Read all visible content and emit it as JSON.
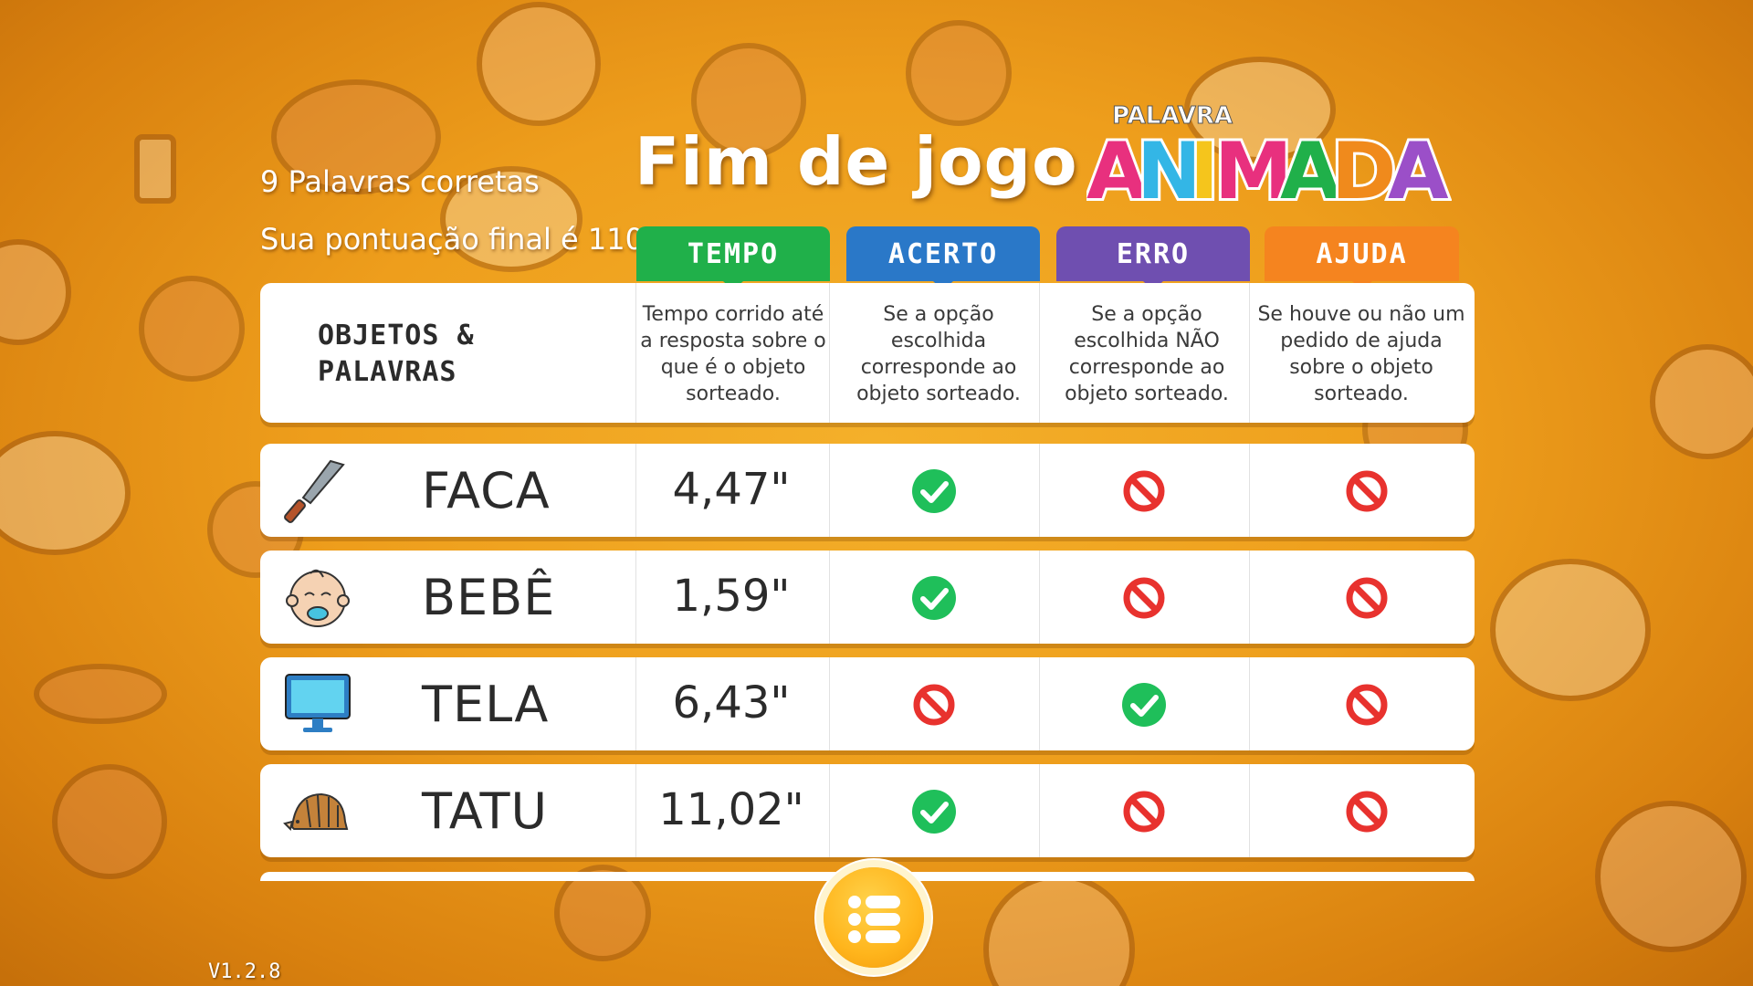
{
  "game": {
    "title": "Fim de jogo",
    "logo": {
      "top": "PALAVRA",
      "main": "ANIMADA"
    },
    "stats": {
      "correct_words": "9 Palavras corretas",
      "final_score": "Sua pontuação final é 110"
    },
    "version": "V1.2.8"
  },
  "table": {
    "header_title_line1": "OBJETOS &",
    "header_title_line2": "PALAVRAS",
    "columns": [
      {
        "label": "TEMPO",
        "color": "#20b04a",
        "description": "Tempo corrido até a resposta sobre o que é o objeto sorteado."
      },
      {
        "label": "ACERTO",
        "color": "#2a78c8",
        "description": "Se a opção escolhida corresponde ao objeto sorteado."
      },
      {
        "label": "ERRO",
        "color": "#6f4fb0",
        "description": "Se a opção escolhida NÃO corresponde ao objeto sorteado."
      },
      {
        "label": "AJUDA",
        "color": "#f5841f",
        "description": "Se houve ou não um pedido de ajuda sobre o objeto sorteado."
      }
    ],
    "rows": [
      {
        "word": "FACA",
        "icon": "knife-icon",
        "time": "4,47\"",
        "acerto": true,
        "erro": false,
        "ajuda": false
      },
      {
        "word": "BEBÊ",
        "icon": "baby-icon",
        "time": "1,59\"",
        "acerto": true,
        "erro": false,
        "ajuda": false
      },
      {
        "word": "TELA",
        "icon": "monitor-icon",
        "time": "6,43\"",
        "acerto": false,
        "erro": true,
        "ajuda": false
      },
      {
        "word": "TATU",
        "icon": "armadillo-icon",
        "time": "11,02\"",
        "acerto": true,
        "erro": false,
        "ajuda": false
      }
    ]
  },
  "colors": {
    "check": "#1fbf5a",
    "no": "#e8322e"
  },
  "menu_button": {
    "icon": "list-menu-icon"
  }
}
